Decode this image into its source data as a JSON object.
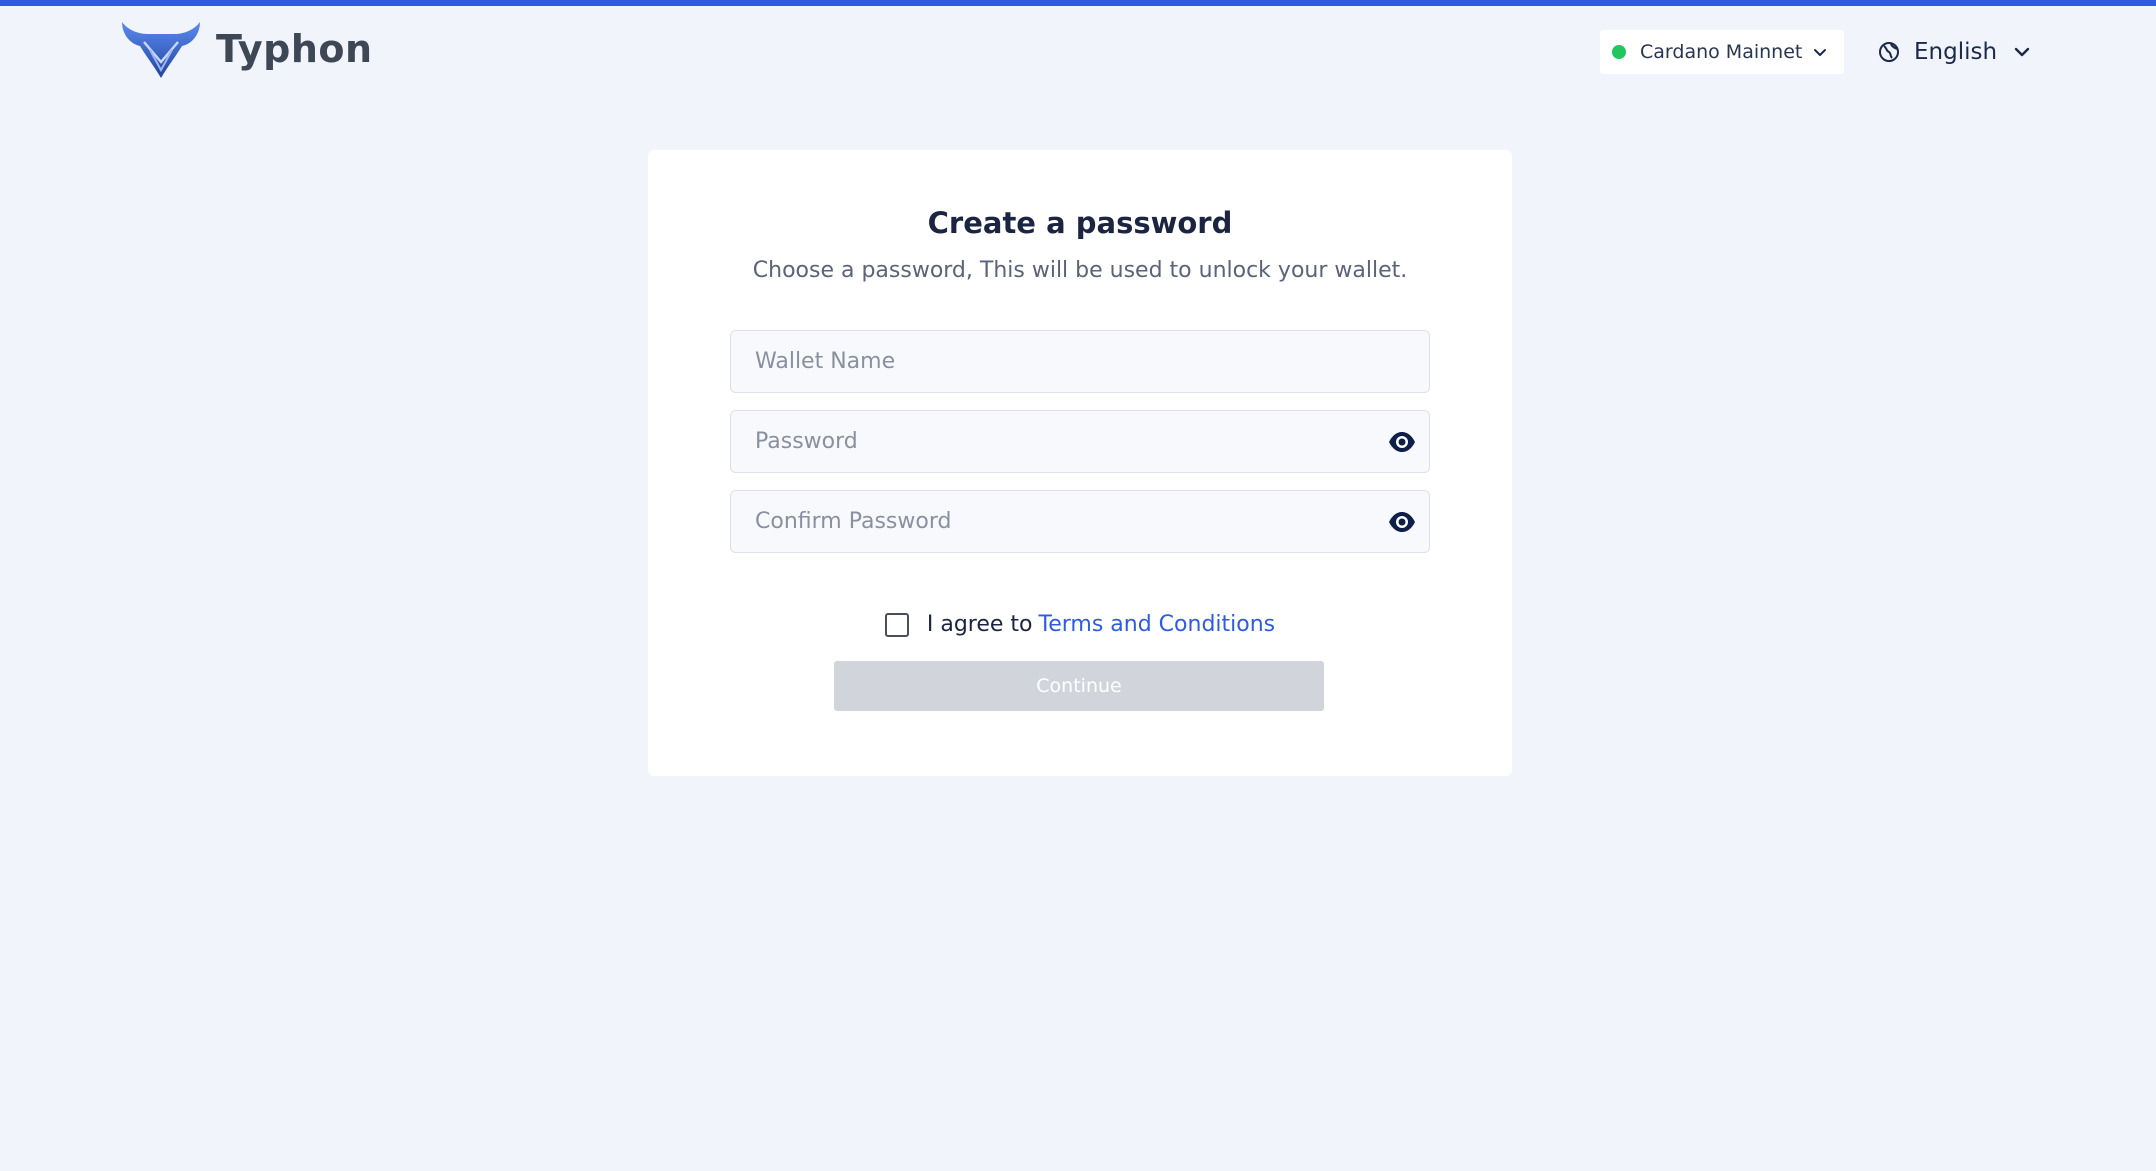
{
  "header": {
    "brand": "Typhon",
    "network": {
      "label": "Cardano Mainnet",
      "status_color": "#22c55e"
    },
    "language": {
      "label": "English"
    }
  },
  "card": {
    "title": "Create a password",
    "subtitle": "Choose a password, This will be used to unlock your wallet.",
    "fields": {
      "wallet_name": {
        "placeholder": "Wallet Name",
        "value": ""
      },
      "password": {
        "placeholder": "Password",
        "value": ""
      },
      "confirm_password": {
        "placeholder": "Confirm Password",
        "value": ""
      }
    },
    "agree": {
      "text": "I agree to",
      "link": "Terms and Conditions",
      "checked": false
    },
    "continue_label": "Continue"
  },
  "colors": {
    "accent": "#2f5be0",
    "background": "#f1f4fb",
    "button_disabled": "#d1d5db"
  },
  "icons": [
    "typhon-logo-icon",
    "chevron-down-icon",
    "globe-icon",
    "eye-icon"
  ]
}
